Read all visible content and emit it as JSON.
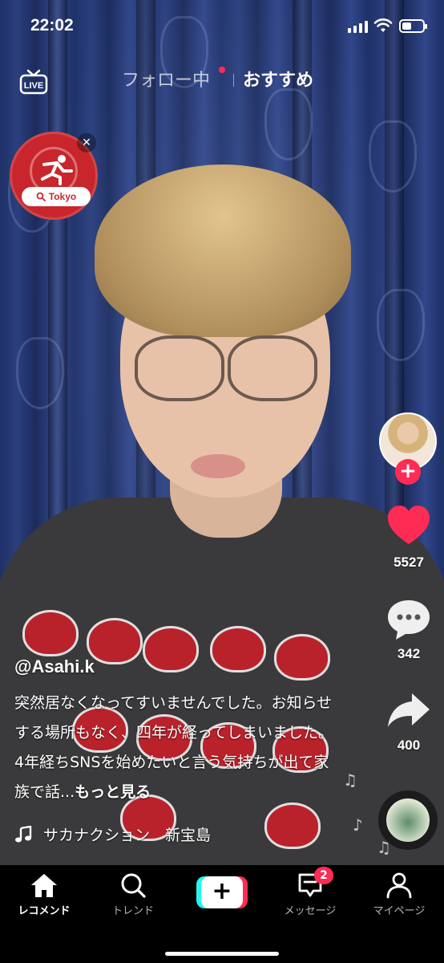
{
  "status_bar": {
    "time": "22:02"
  },
  "top_nav": {
    "tab_following": "フォロー中",
    "tab_recommended": "おすすめ",
    "live_label": "LIVE"
  },
  "promo_badge": {
    "label": "Tokyo"
  },
  "rail": {
    "likes": "5527",
    "comments": "342",
    "shares": "400"
  },
  "caption": {
    "username": "@Asahi.k",
    "text": "突然居なくなってすいませんでした。お知らせする場所もなく、四年が経ってしまいました。4年経ちSNSを始めたいと言う気持ちが出て家族で話...",
    "more": "もっと見る"
  },
  "music": {
    "title": "サカナクション　新宝島"
  },
  "bottom_nav": {
    "home": "レコメンド",
    "trend": "トレンド",
    "messages": "メッセージ",
    "messages_badge": "2",
    "mypage": "マイページ"
  },
  "colors": {
    "accent": "#fe2c55",
    "cyan": "#25f4ee",
    "badge_red": "#c8262c"
  },
  "icons": [
    "live-tv-icon",
    "search-icon",
    "heart-icon",
    "comment-icon",
    "share-icon",
    "music-note-icon",
    "home-icon",
    "inbox-icon",
    "profile-icon",
    "plus-icon",
    "close-icon",
    "runner-icon"
  ]
}
